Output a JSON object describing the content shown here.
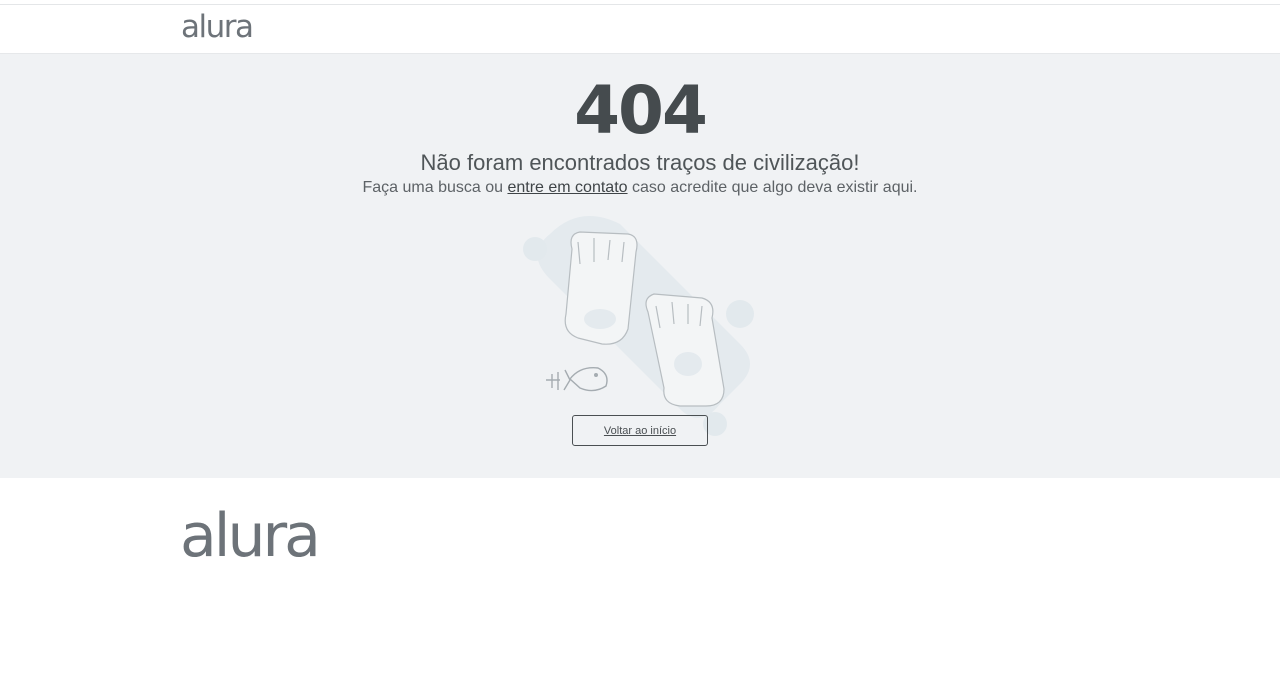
{
  "header": {
    "logo_text": "alura"
  },
  "error_page": {
    "code": "404",
    "title": "Não foram encontrados traços de civilização!",
    "subtitle_before": "Faça uma busca ou ",
    "contact_link": "entre em contato",
    "subtitle_after": " caso acredite que algo deva existir aqui.",
    "back_button": "Voltar ao início"
  },
  "footer": {
    "logo_text": "alura"
  },
  "colors": {
    "page_background": "#f0f2f4",
    "heading": "#454b4e",
    "logo": "#6d7379"
  }
}
